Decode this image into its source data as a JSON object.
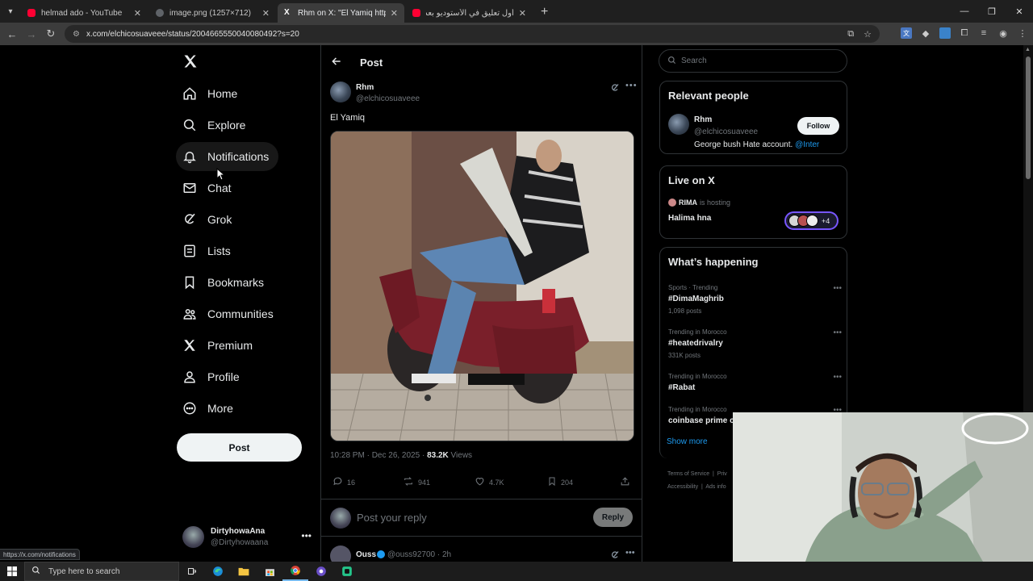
{
  "browser": {
    "tabs": [
      {
        "title": "helmad ado - YouTube",
        "favicon": "youtube-icon",
        "color": "#ff0033",
        "active": false
      },
      {
        "title": "image.png (1257×712)",
        "favicon": "globe-icon",
        "color": "#9aa0a6",
        "active": false
      },
      {
        "title": "Rhm on X: \"El Yamiq https://t.co",
        "favicon": "x-icon",
        "color": "#ffffff",
        "active": true
      },
      {
        "title": "أول تعليق في الأستوديو بعد تعادل",
        "favicon": "youtube-icon",
        "color": "#ff0033",
        "active": false
      }
    ],
    "url": "x.com/elchicosuaveee/status/2004665550040080492?s=20",
    "status_url": "https://x.com/notifications"
  },
  "sidebar": {
    "items": [
      {
        "label": "Home",
        "icon": "home-icon"
      },
      {
        "label": "Explore",
        "icon": "search-icon"
      },
      {
        "label": "Notifications",
        "icon": "bell-icon"
      },
      {
        "label": "Chat",
        "icon": "mail-icon"
      },
      {
        "label": "Grok",
        "icon": "grok-icon"
      },
      {
        "label": "Lists",
        "icon": "list-icon"
      },
      {
        "label": "Bookmarks",
        "icon": "bookmark-icon"
      },
      {
        "label": "Communities",
        "icon": "communities-icon"
      },
      {
        "label": "Premium",
        "icon": "x-icon"
      },
      {
        "label": "Profile",
        "icon": "person-icon"
      },
      {
        "label": "More",
        "icon": "more-circle-icon"
      }
    ],
    "post_label": "Post",
    "account": {
      "name": "DirtyhowaAna",
      "handle": "@Dirtyhowaana"
    }
  },
  "main": {
    "title": "Post",
    "tweet": {
      "name": "Rhm",
      "handle": "@elchicosuaveee",
      "text": "El Yamiq",
      "time": "10:28 PM · Dec 26, 2025 · ",
      "views_count": "83.2K",
      "views_label": " Views",
      "replies": "16",
      "reposts": "941",
      "likes": "4.7K",
      "bookmarks": "204"
    },
    "reply_placeholder": "Post your reply",
    "reply_label": "Reply",
    "next_tweet": {
      "name": "Ouss",
      "handle": "@ouss92700 · 2h"
    }
  },
  "right": {
    "search_placeholder": "Search",
    "relevant": {
      "title": "Relevant people",
      "name": "Rhm",
      "handle": "@elchicosuaveee",
      "follow_label": "Follow",
      "bio": "George bush Hate account. ",
      "bio_link": "@Inter"
    },
    "live": {
      "title": "Live on X",
      "host": "RIMA",
      "hosting": "is hosting",
      "space_title": "Halima hna",
      "extra_count": "+4"
    },
    "happening": {
      "title": "What’s happening",
      "trends": [
        {
          "category": "Sports · Trending",
          "name": "#DimaMaghrib",
          "posts": "1,098 posts"
        },
        {
          "category": "Trending in Morocco",
          "name": "#heatedrivalry",
          "posts": "331K posts"
        },
        {
          "category": "Trending in Morocco",
          "name": "#Rabat",
          "posts": ""
        },
        {
          "category": "Trending in Morocco",
          "name": "coinbase prime c",
          "posts": ""
        }
      ],
      "show_more": "Show more"
    },
    "footer": {
      "terms": "Terms of Service",
      "privacy": "Priv",
      "accessibility": "Accessibility",
      "ads": "Ads info"
    }
  },
  "taskbar": {
    "search_placeholder": "Type here to search"
  }
}
